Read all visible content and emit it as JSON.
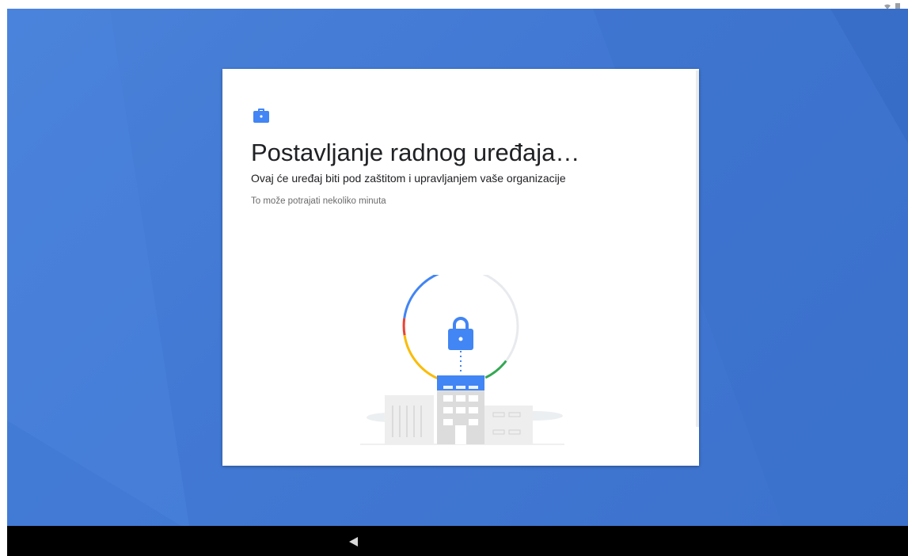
{
  "setup": {
    "title": "Postavljanje radnog uređaja…",
    "subtitle": "Ovaj će uređaj biti pod zaštitom i upravljanjem vaše organizacije",
    "note": "To može potrajati nekoliko minuta"
  },
  "icons": {
    "work": "briefcase-icon",
    "illustration": "lock-building-icon",
    "back": "back-triangle-icon",
    "status": "wifi-battery-icon"
  },
  "colors": {
    "wallpaper": "#4279d4",
    "accent": "#4285f4",
    "progress_red": "#ea4335",
    "progress_yellow": "#fbbc04",
    "progress_green": "#34a853",
    "progress_track": "#e8eaed"
  }
}
